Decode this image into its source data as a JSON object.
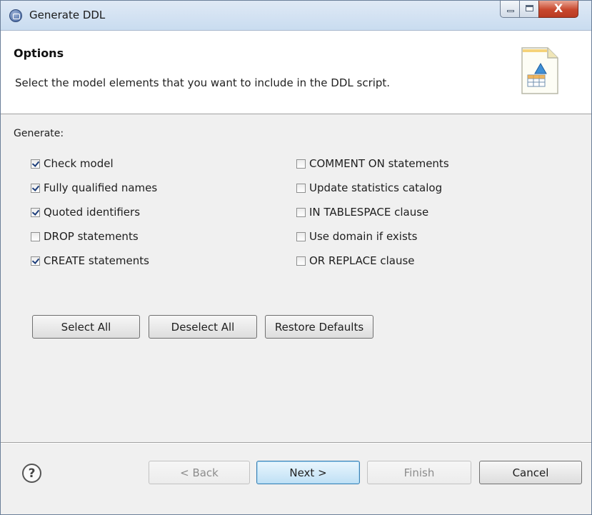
{
  "window": {
    "title": "Generate DDL",
    "icons": {
      "app": "db-app-icon",
      "minimize": "minimize-icon",
      "maximize": "maximize-icon",
      "close": "close-icon"
    },
    "close_glyph": "X"
  },
  "header": {
    "title": "Options",
    "description": "Select the model elements that you want to include in the DDL script.",
    "icon": "ddl-script-icon"
  },
  "options": {
    "label": "Generate:",
    "left": [
      {
        "label": "Check model",
        "checked": true
      },
      {
        "label": "Fully qualified names",
        "checked": true
      },
      {
        "label": "Quoted identifiers",
        "checked": true
      },
      {
        "label": "DROP statements",
        "checked": false
      },
      {
        "label": "CREATE statements",
        "checked": true
      }
    ],
    "right": [
      {
        "label": "COMMENT ON statements",
        "checked": false
      },
      {
        "label": "Update statistics catalog",
        "checked": false
      },
      {
        "label": "IN TABLESPACE clause",
        "checked": false
      },
      {
        "label": "Use domain if exists",
        "checked": false
      },
      {
        "label": "OR REPLACE clause",
        "checked": false
      }
    ]
  },
  "selection_buttons": {
    "select_all": "Select All",
    "deselect_all": "Deselect All",
    "restore_defaults": "Restore Defaults"
  },
  "footer": {
    "help_glyph": "?",
    "back": "< Back",
    "next": "Next >",
    "finish": "Finish",
    "cancel": "Cancel",
    "back_enabled": false,
    "finish_enabled": false
  },
  "colors": {
    "title_bar": "#c9dcf0",
    "close_button": "#c8472d",
    "default_button": "#bfe0f5",
    "dialog_bg": "#f0f0f0"
  }
}
